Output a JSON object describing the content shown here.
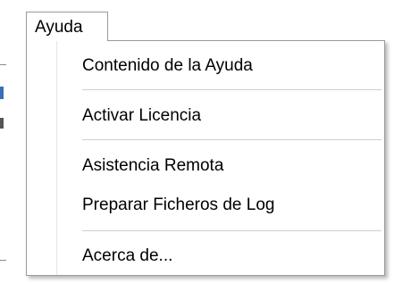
{
  "menu": {
    "title": "Ayuda",
    "items": [
      {
        "label": "Contenido de la Ayuda"
      },
      {
        "label": "Activar Licencia"
      },
      {
        "label": "Asistencia Remota"
      },
      {
        "label": "Preparar Ficheros de Log"
      },
      {
        "label": "Acerca de..."
      }
    ]
  },
  "colors": {
    "menu_border": "#9a9a9a",
    "separator": "#cfcfcf",
    "background": "#ffffff",
    "text": "#000000"
  }
}
